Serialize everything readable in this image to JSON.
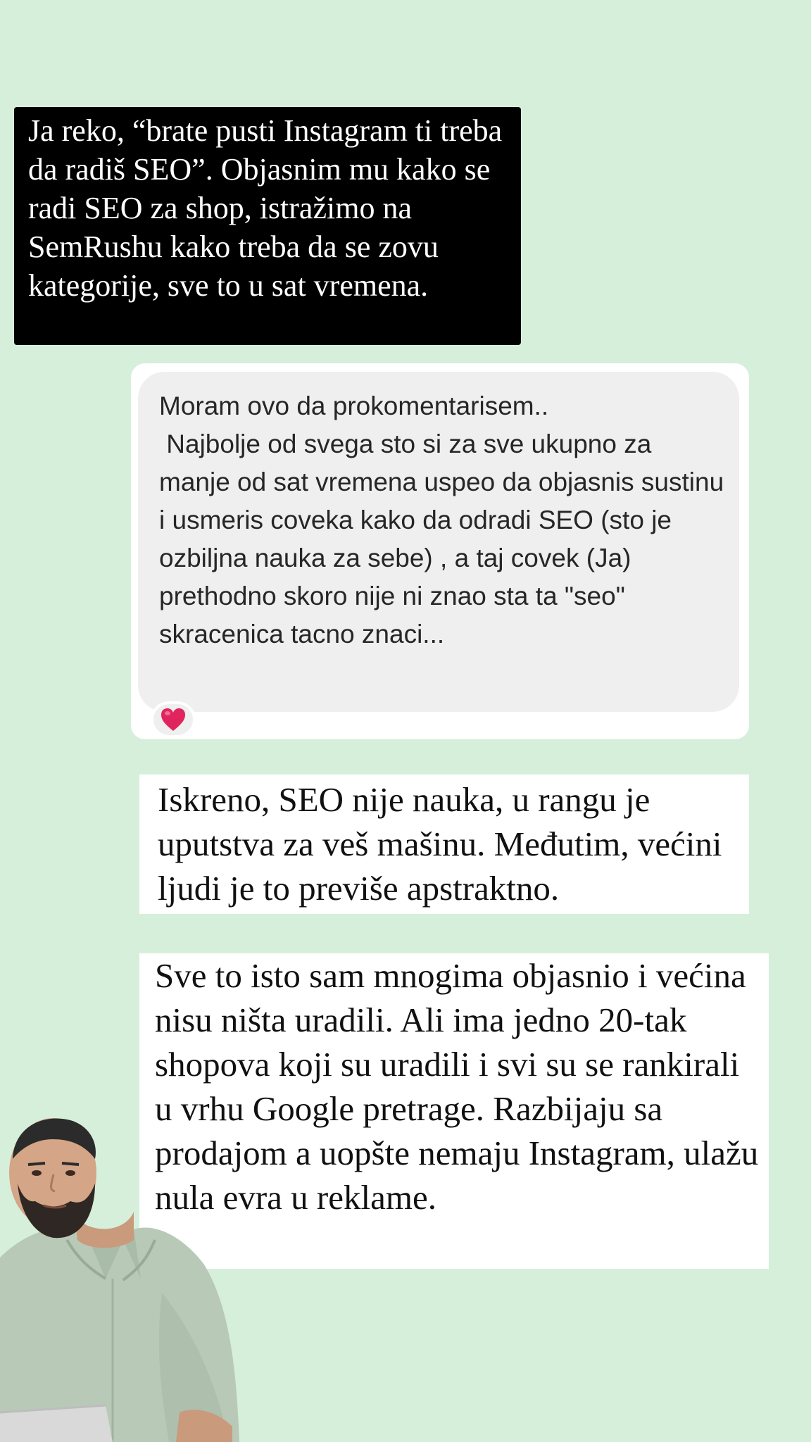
{
  "story": {
    "black_card": {
      "text": "Ja reko, “brate pusti Instagram ti treba da radiš SEO”. Objasnim mu kako se radi SEO za shop, istražimo na SemRushu kako treba da se zovu kategorije, sve to u sat vremena."
    },
    "chat_message": {
      "text": "Moram ovo da prokomentarisem..\n Najbolje od svega sto si za sve ukupno za manje od sat vremena uspeo da objasnis sustinu i usmeris coveka kako da odradi SEO (sto je ozbiljna nauka za sebe) , a taj covek (Ja) prethodno skoro nije ni znao sta ta \"seo\" skracenica tacno znaci...",
      "reaction": "❤️"
    },
    "reply_card_1": {
      "text": "Iskreno, SEO nije nauka, u rangu je uputstva za veš mašinu. Međutim, većini ljudi je to previše apstraktno."
    },
    "reply_card_2": {
      "text": "Sve to isto sam mnogima objasnio i većina nisu ništa uradili. Ali ima jedno 20-tak shopova koji su uradili i svi su se rankirali u vrhu Google pretrage. Razbijaju sa prodajom a uopšte nemaju Instagram, ulažu nula evra u reklame."
    }
  },
  "colors": {
    "background": "#d6efdb",
    "bubble": "#efefef",
    "heart": "#e0245e"
  }
}
